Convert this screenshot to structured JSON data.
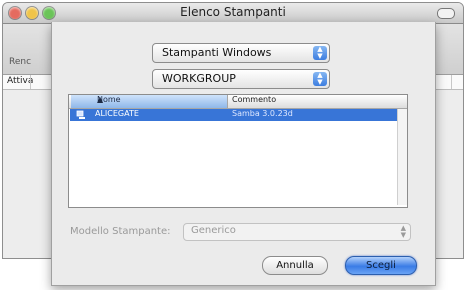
{
  "window": {
    "title": "Elenco Stampanti"
  },
  "toolbar": {
    "label": "Renc"
  },
  "columns": {
    "first": "Attiva"
  },
  "sheet": {
    "connection_type": "Stampanti Windows",
    "workgroup": "WORKGROUP",
    "printer_list": {
      "headers": [
        "Nome",
        "Commento"
      ],
      "rows": [
        {
          "name": "ALICEGATE",
          "comment": "Samba 3.0.23d",
          "selected": true
        }
      ]
    },
    "model": {
      "label": "Modello Stampante:",
      "value": "Generico"
    },
    "buttons": {
      "cancel": "Annulla",
      "choose": "Scegli"
    }
  },
  "colors": {
    "selection": "#3875d7",
    "default_button": "#3a7ce6"
  }
}
